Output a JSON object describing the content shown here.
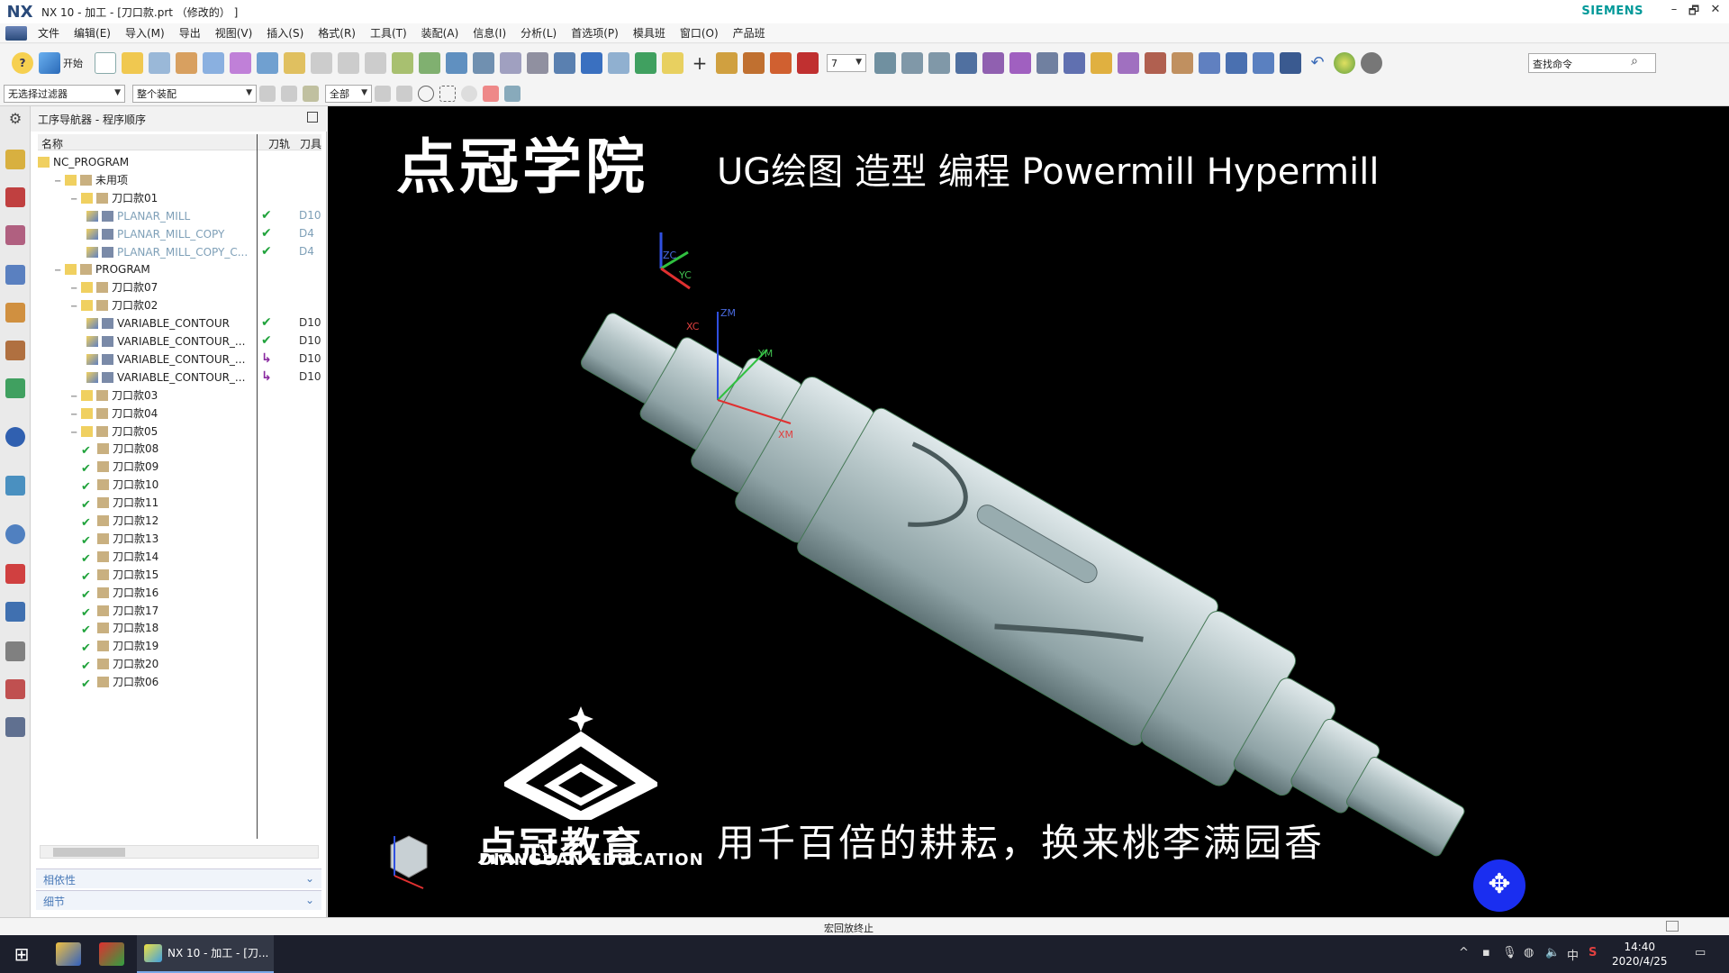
{
  "window": {
    "logo": "NX",
    "title": "NX 10 - 加工 - [刀口款.prt （修改的） ]",
    "brand": "SIEMENS",
    "controls": [
      "–",
      "🗗",
      "✕"
    ]
  },
  "menu": [
    "文件",
    "编辑(E)",
    "导入(M)",
    "导出",
    "视图(V)",
    "插入(S)",
    "格式(R)",
    "工具(T)",
    "装配(A)",
    "信息(I)",
    "分析(L)",
    "首选项(P)",
    "模具班",
    "窗口(O)",
    "产品班"
  ],
  "toolbar": {
    "start_label": "开始",
    "zoom_value": "7",
    "search_placeholder": "查找命令"
  },
  "toolbar2": {
    "filter": "无选择过滤器",
    "assembly": "整个装配",
    "scope": "全部"
  },
  "navigator": {
    "title": "工序导航器 - 程序顺序",
    "columns": {
      "name": "名称",
      "path": "刀轨",
      "tool": "刀具"
    },
    "rows": [
      {
        "label": "NC_PROGRAM",
        "level": 0,
        "check": "",
        "tool": ""
      },
      {
        "label": "未用项",
        "level": 1,
        "check": "",
        "tool": ""
      },
      {
        "label": "刀口款01",
        "level": 2,
        "check": "",
        "tool": ""
      },
      {
        "label": "PLANAR_MILL",
        "level": 3,
        "check": "✔",
        "tool": "D10",
        "dim": true
      },
      {
        "label": "PLANAR_MILL_COPY",
        "level": 3,
        "check": "✔",
        "tool": "D4",
        "dim": true
      },
      {
        "label": "PLANAR_MILL_COPY_C...",
        "level": 3,
        "check": "✔",
        "tool": "D4",
        "dim": true
      },
      {
        "label": "PROGRAM",
        "level": 1,
        "check": "",
        "tool": ""
      },
      {
        "label": "刀口款07",
        "level": 2,
        "check": "",
        "tool": ""
      },
      {
        "label": "刀口款02",
        "level": 2,
        "check": "",
        "tool": ""
      },
      {
        "label": "VARIABLE_CONTOUR",
        "level": 3,
        "check": "✔",
        "tool": "D10"
      },
      {
        "label": "VARIABLE_CONTOUR_...",
        "level": 3,
        "check": "✔",
        "tool": "D10"
      },
      {
        "label": "VARIABLE_CONTOUR_...",
        "level": 3,
        "check": "↳",
        "tool": "D10"
      },
      {
        "label": "VARIABLE_CONTOUR_...",
        "level": 3,
        "check": "↳",
        "tool": "D10"
      },
      {
        "label": "刀口款03",
        "level": 2,
        "check": "",
        "tool": ""
      },
      {
        "label": "刀口款04",
        "level": 2,
        "check": "",
        "tool": ""
      },
      {
        "label": "刀口款05",
        "level": 2,
        "check": "",
        "tool": ""
      },
      {
        "label": "刀口款08",
        "level": 2,
        "check": "",
        "tool": "",
        "done": true
      },
      {
        "label": "刀口款09",
        "level": 2,
        "check": "",
        "tool": "",
        "done": true
      },
      {
        "label": "刀口款10",
        "level": 2,
        "check": "",
        "tool": "",
        "done": true
      },
      {
        "label": "刀口款11",
        "level": 2,
        "check": "",
        "tool": "",
        "done": true
      },
      {
        "label": "刀口款12",
        "level": 2,
        "check": "",
        "tool": "",
        "done": true
      },
      {
        "label": "刀口款13",
        "level": 2,
        "check": "",
        "tool": "",
        "done": true
      },
      {
        "label": "刀口款14",
        "level": 2,
        "check": "",
        "tool": "",
        "done": true
      },
      {
        "label": "刀口款15",
        "level": 2,
        "check": "",
        "tool": "",
        "done": true
      },
      {
        "label": "刀口款16",
        "level": 2,
        "check": "",
        "tool": "",
        "done": true
      },
      {
        "label": "刀口款17",
        "level": 2,
        "check": "",
        "tool": "",
        "done": true
      },
      {
        "label": "刀口款18",
        "level": 2,
        "check": "",
        "tool": "",
        "done": true
      },
      {
        "label": "刀口款19",
        "level": 2,
        "check": "",
        "tool": "",
        "done": true
      },
      {
        "label": "刀口款20",
        "level": 2,
        "check": "",
        "tool": "",
        "done": true
      },
      {
        "label": "刀口款06",
        "level": 2,
        "check": "",
        "tool": "",
        "done": true
      }
    ],
    "accordion": [
      "相依性",
      "细节"
    ]
  },
  "viewport": {
    "title_big": "点冠学院",
    "title_small": "UG绘图 造型 编程 Powermill Hypermill",
    "brand": "点冠教育",
    "brand_en": "DIANGUAN EDUCATION",
    "slogan": "用千百倍的耕耘，换来桃李满园香",
    "axes": {
      "zc": "ZC",
      "yc": "YC",
      "xc": "XC",
      "zm": "ZM",
      "ym": "YM",
      "xm": "XM"
    }
  },
  "status": {
    "text": "宏回放终止"
  },
  "taskbar": {
    "active_app": "NX 10 - 加工 - [刀...",
    "ime": "中",
    "time": "14:40",
    "date": "2020/4/25"
  },
  "colors": {
    "accent": "#1a2ef0",
    "check": "#21a33c",
    "siemens": "#009999"
  }
}
